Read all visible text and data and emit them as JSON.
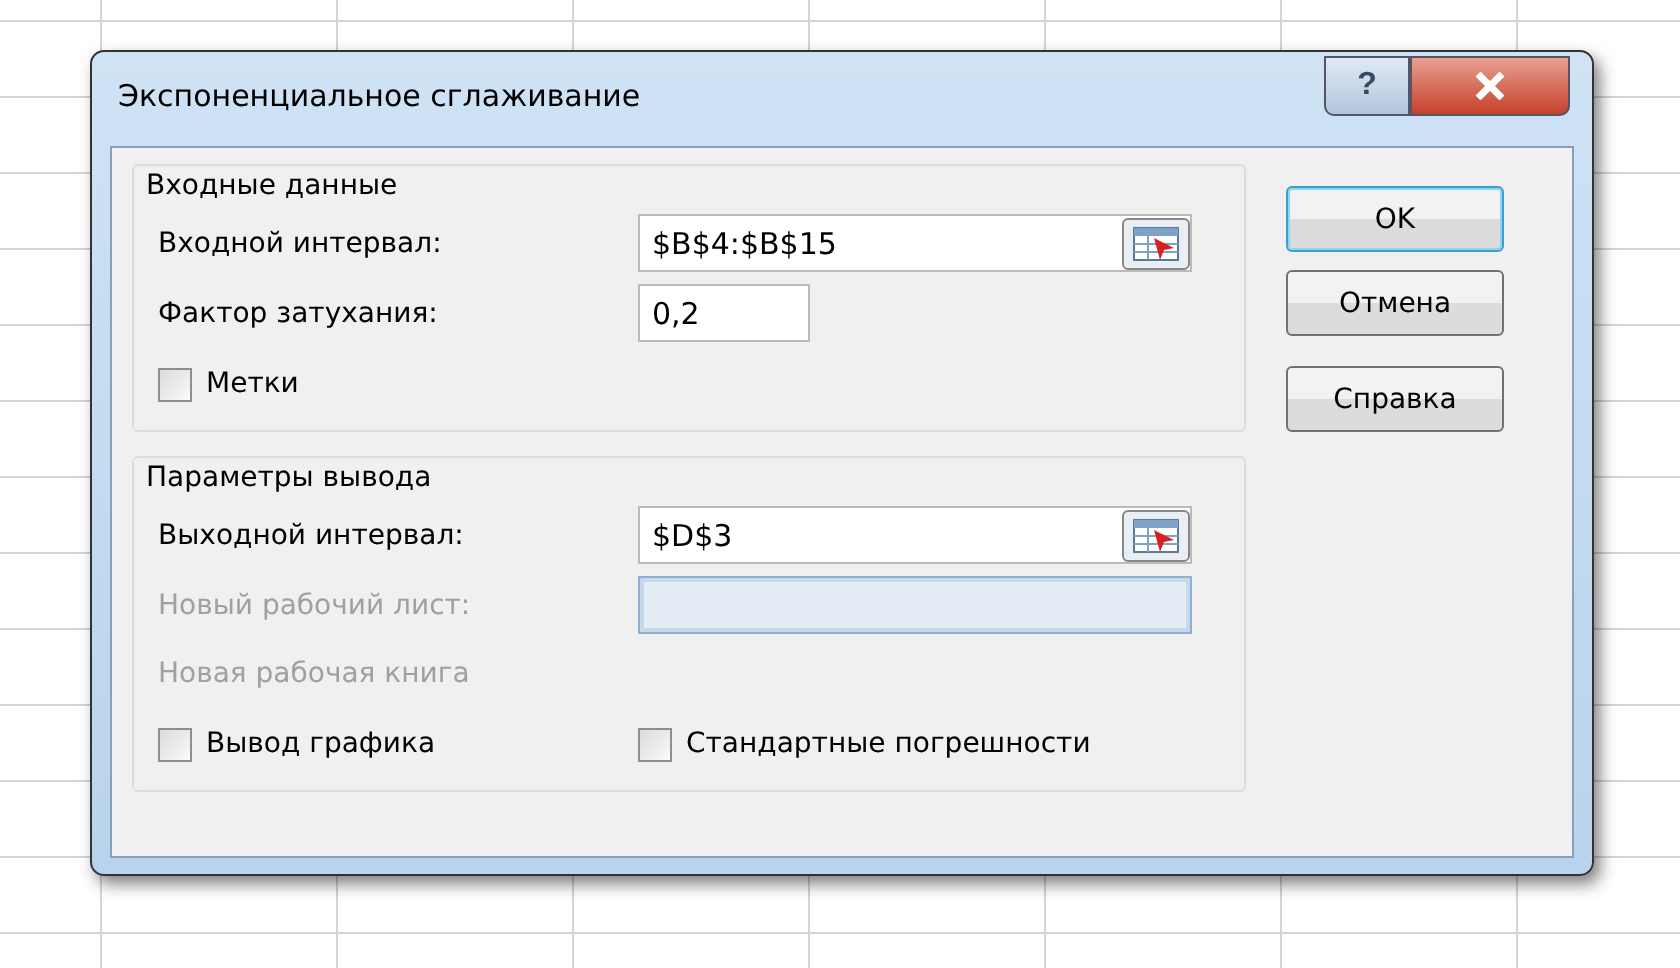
{
  "window": {
    "title": "Экспоненциальное сглаживание",
    "help_button": "?"
  },
  "groups": [
    {
      "title": "Входные данные",
      "rows": [
        {
          "kind": "range",
          "label": "Входной интервал:",
          "value": "$B$4:$B$15",
          "disabled": false
        },
        {
          "kind": "text",
          "label": "Фактор затухания:",
          "value": "0,2",
          "disabled": false
        },
        {
          "kind": "checks",
          "items": [
            {
              "label": "Метки",
              "checked": false
            }
          ]
        }
      ]
    },
    {
      "title": "Параметры вывода",
      "rows": [
        {
          "kind": "range",
          "label": "Выходной интервал:",
          "value": "$D$3",
          "disabled": false
        },
        {
          "kind": "wide",
          "label": "Новый рабочий лист:",
          "value": "",
          "disabled": true
        },
        {
          "kind": "label",
          "label": "Новая рабочая книга",
          "disabled": true
        },
        {
          "kind": "checks",
          "items": [
            {
              "label": "Вывод графика",
              "checked": false
            },
            {
              "label": "Стандартные погрешности",
              "checked": false
            }
          ]
        }
      ]
    }
  ],
  "buttons": [
    {
      "label": "OK",
      "default": true
    },
    {
      "label": "Отмена",
      "default": false
    },
    {
      "label": "Справка",
      "default": false
    }
  ]
}
